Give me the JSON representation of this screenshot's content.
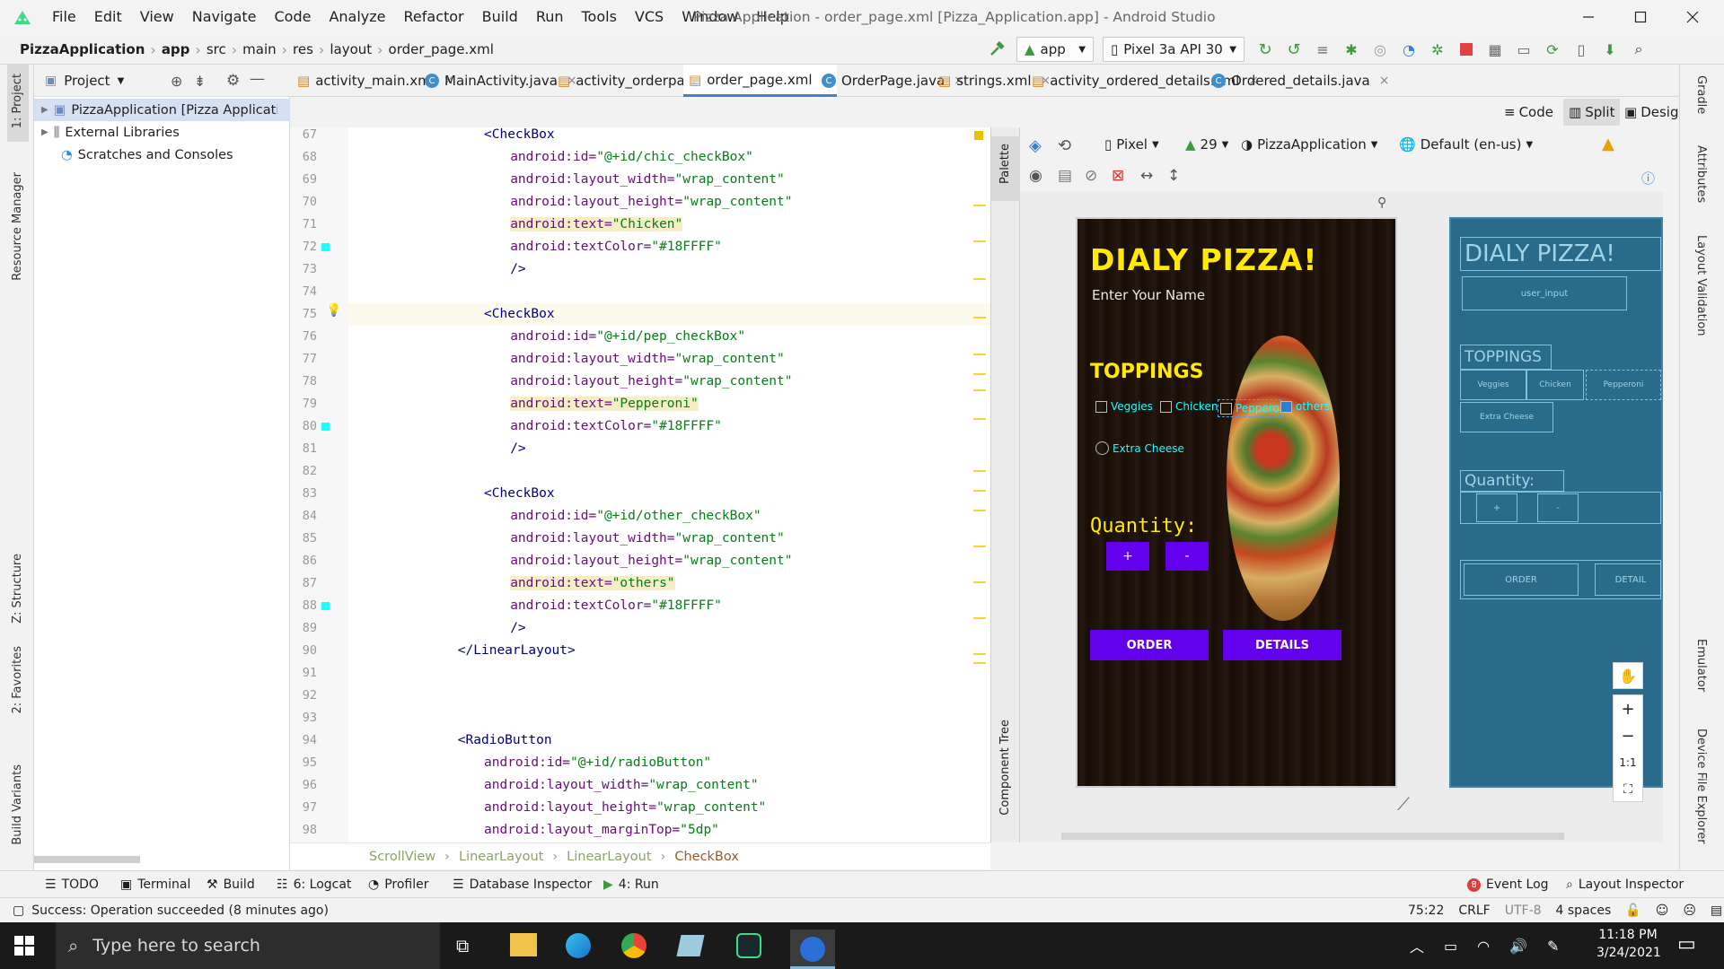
{
  "window": {
    "title": "Pizza Application - order_page.xml [Pizza_Application.app] - Android Studio",
    "menu": [
      "File",
      "Edit",
      "View",
      "Navigate",
      "Code",
      "Analyze",
      "Refactor",
      "Build",
      "Run",
      "Tools",
      "VCS",
      "Window",
      "Help"
    ]
  },
  "breadcrumb": [
    "PizzaApplication",
    "app",
    "src",
    "main",
    "res",
    "layout",
    "order_page.xml"
  ],
  "toolbar": {
    "run_config": "app",
    "device": "Pixel 3a API 30"
  },
  "project_panel": {
    "title": "Project",
    "items": [
      "PizzaApplication [Pizza Application]",
      "External Libraries",
      "Scratches and Consoles"
    ]
  },
  "tabs": [
    {
      "label": "activity_main.xml",
      "type": "xml"
    },
    {
      "label": "MainActivity.java",
      "type": "java"
    },
    {
      "label": "activity_orderpage.xml",
      "type": "xml"
    },
    {
      "label": "order_page.xml",
      "type": "xml",
      "active": true
    },
    {
      "label": "OrderPage.java",
      "type": "java"
    },
    {
      "label": "strings.xml",
      "type": "xml"
    },
    {
      "label": "activity_ordered_details.xml",
      "type": "xml"
    },
    {
      "label": "Ordered_details.java",
      "type": "java"
    }
  ],
  "view_modes": {
    "code": "Code",
    "split": "Split",
    "design": "Design"
  },
  "design_toolbar": {
    "device": "Pixel",
    "api": "29",
    "theme": "PizzaApplication",
    "locale": "Default (en-us)"
  },
  "code_lines": [
    {
      "n": "67",
      "indent": 5,
      "parts": [
        [
          "tag",
          "<CheckBox"
        ]
      ]
    },
    {
      "n": "68",
      "indent": 6,
      "parts": [
        [
          "attr",
          "android:id="
        ],
        [
          "val",
          "\"@+id/chic_checkBox\""
        ]
      ]
    },
    {
      "n": "69",
      "indent": 6,
      "parts": [
        [
          "attr",
          "android:layout_width="
        ],
        [
          "val",
          "\"wrap_content\""
        ]
      ]
    },
    {
      "n": "70",
      "indent": 6,
      "parts": [
        [
          "attr",
          "android:layout_height="
        ],
        [
          "val",
          "\"wrap_content\""
        ]
      ]
    },
    {
      "n": "71",
      "indent": 6,
      "hl": true,
      "parts": [
        [
          "attr",
          "android:text="
        ],
        [
          "val",
          "\"Chicken\""
        ]
      ]
    },
    {
      "n": "72",
      "indent": 6,
      "parts": [
        [
          "attr",
          "android:textColor="
        ],
        [
          "val",
          "\"#18FFFF\""
        ]
      ]
    },
    {
      "n": "73",
      "indent": 6,
      "parts": [
        [
          "tag",
          "/>"
        ]
      ]
    },
    {
      "n": "74",
      "indent": 0,
      "parts": []
    },
    {
      "n": "75",
      "indent": 5,
      "cur": true,
      "parts": [
        [
          "tag",
          "<CheckBox"
        ]
      ]
    },
    {
      "n": "76",
      "indent": 6,
      "parts": [
        [
          "attr",
          "android:id="
        ],
        [
          "val",
          "\"@+id/pep_checkBox\""
        ]
      ]
    },
    {
      "n": "77",
      "indent": 6,
      "parts": [
        [
          "attr",
          "android:layout_width="
        ],
        [
          "val",
          "\"wrap_content\""
        ]
      ]
    },
    {
      "n": "78",
      "indent": 6,
      "parts": [
        [
          "attr",
          "android:layout_height="
        ],
        [
          "val",
          "\"wrap_content\""
        ]
      ]
    },
    {
      "n": "79",
      "indent": 6,
      "hl": true,
      "parts": [
        [
          "attr",
          "android:text="
        ],
        [
          "val",
          "\"Pepperoni\""
        ]
      ]
    },
    {
      "n": "80",
      "indent": 6,
      "parts": [
        [
          "attr",
          "android:textColor="
        ],
        [
          "val",
          "\"#18FFFF\""
        ]
      ]
    },
    {
      "n": "81",
      "indent": 6,
      "parts": [
        [
          "tag",
          "/>"
        ]
      ]
    },
    {
      "n": "82",
      "indent": 0,
      "parts": []
    },
    {
      "n": "83",
      "indent": 5,
      "parts": [
        [
          "tag",
          "<CheckBox"
        ]
      ]
    },
    {
      "n": "84",
      "indent": 6,
      "parts": [
        [
          "attr",
          "android:id="
        ],
        [
          "val",
          "\"@+id/other_checkBox\""
        ]
      ]
    },
    {
      "n": "85",
      "indent": 6,
      "parts": [
        [
          "attr",
          "android:layout_width="
        ],
        [
          "val",
          "\"wrap_content\""
        ]
      ]
    },
    {
      "n": "86",
      "indent": 6,
      "parts": [
        [
          "attr",
          "android:layout_height="
        ],
        [
          "val",
          "\"wrap_content\""
        ]
      ]
    },
    {
      "n": "87",
      "indent": 6,
      "hl": true,
      "parts": [
        [
          "attr",
          "android:text="
        ],
        [
          "val",
          "\"others\""
        ]
      ]
    },
    {
      "n": "88",
      "indent": 6,
      "parts": [
        [
          "attr",
          "android:textColor="
        ],
        [
          "val",
          "\"#18FFFF\""
        ]
      ]
    },
    {
      "n": "89",
      "indent": 6,
      "parts": [
        [
          "tag",
          "/>"
        ]
      ]
    },
    {
      "n": "90",
      "indent": 4,
      "parts": [
        [
          "tag",
          "</LinearLayout>"
        ]
      ]
    },
    {
      "n": "91",
      "indent": 0,
      "parts": []
    },
    {
      "n": "92",
      "indent": 0,
      "parts": []
    },
    {
      "n": "93",
      "indent": 0,
      "parts": []
    },
    {
      "n": "94",
      "indent": 4,
      "parts": [
        [
          "tag",
          "<RadioButton"
        ]
      ]
    },
    {
      "n": "95",
      "indent": 5,
      "parts": [
        [
          "attr",
          "android:id="
        ],
        [
          "val",
          "\"@+id/radioButton\""
        ]
      ]
    },
    {
      "n": "96",
      "indent": 5,
      "parts": [
        [
          "attr",
          "android:layout_width="
        ],
        [
          "val",
          "\"wrap_content\""
        ]
      ]
    },
    {
      "n": "97",
      "indent": 5,
      "parts": [
        [
          "attr",
          "android:layout_height="
        ],
        [
          "val",
          "\"wrap_content\""
        ]
      ]
    },
    {
      "n": "98",
      "indent": 5,
      "parts": [
        [
          "attr",
          "android:layout_marginTop="
        ],
        [
          "val",
          "\"5dp\""
        ]
      ]
    }
  ],
  "editor_breadcrumb": [
    "ScrollView",
    "LinearLayout",
    "LinearLayout",
    "CheckBox"
  ],
  "phone": {
    "title": "DIALY PIZZA!",
    "name_hint": "Enter Your Name",
    "toppings": "TOPPINGS",
    "checks": [
      "Veggies",
      "Chicken",
      "Pepperoni",
      "others"
    ],
    "extra": "Extra Cheese",
    "quantity": "Quantity:",
    "plus": "+",
    "minus": "-",
    "order": "ORDER",
    "details": "DETAILS"
  },
  "blueprint": {
    "title": "DIALY PIZZA!",
    "input": "user_input",
    "toppings": "TOPPINGS",
    "checks": [
      "Veggies",
      "Chicken",
      "Pepperoni"
    ],
    "extra": "Extra Cheese",
    "quantity": "Quantity:",
    "plus": "+",
    "minus": "-",
    "order": "ORDER",
    "details": "DETAIL"
  },
  "zoom_controls": {
    "ratio": "1:1"
  },
  "side_tabs_left": [
    "1: Project",
    "Resource Manager",
    "Z: Structure",
    "2: Favorites",
    "Build Variants"
  ],
  "side_tabs_right": [
    "Gradle",
    "Attributes",
    "Layout Validation",
    "Emulator",
    "Device File Explorer"
  ],
  "palette_tabs": [
    "Palette",
    "Component Tree"
  ],
  "bottom_tools": [
    "TODO",
    "Terminal",
    "Build",
    "6: Logcat",
    "Profiler",
    "Database Inspector",
    "4: Run"
  ],
  "bottom_tools_right": [
    "Event Log",
    "Layout Inspector"
  ],
  "event_count": "8",
  "status": {
    "message": "Success: Operation succeeded (8 minutes ago)",
    "position": "75:22",
    "line_sep": "CRLF",
    "encoding": "UTF-8",
    "indent": "4 spaces"
  },
  "taskbar": {
    "search": "Type here to search",
    "time": "11:18 PM",
    "date": "3/24/2021"
  },
  "colors": {
    "accent": "#4083c9",
    "phone_button": "#6200ee",
    "checkbox_text": "#18FFFF",
    "title_yellow": "#ffea00"
  }
}
